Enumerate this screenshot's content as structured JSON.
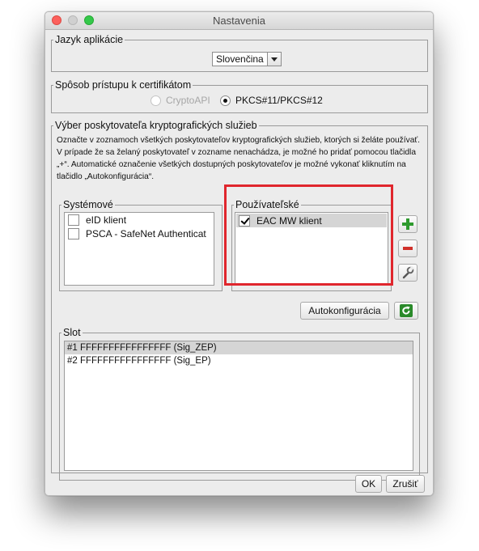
{
  "window": {
    "title": "Nastavenia"
  },
  "language": {
    "legend": "Jazyk aplikácie",
    "selected": "Slovenčina"
  },
  "access": {
    "legend": "Spôsob prístupu k certifikátom",
    "options": [
      {
        "label": "CryptoAPI",
        "selected": false,
        "enabled": false
      },
      {
        "label": "PKCS#11/PKCS#12",
        "selected": true,
        "enabled": true
      }
    ]
  },
  "providers": {
    "legend": "Výber poskytovateľa kryptografických služieb",
    "description": "Označte v zoznamoch všetkých poskytovateľov kryptografických služieb, ktorých si želáte používať. V prípade že sa želaný poskytovateľ v zozname nenachádza, je možné ho pridať pomocou tlačidla „+“. Automatické označenie všetkých dostupných poskytovateľov je možné vykonať kliknutím na tlačidlo „Autokonfigurácia“.",
    "system": {
      "legend": "Systémové",
      "items": [
        {
          "label": "eID klient",
          "checked": false
        },
        {
          "label": "PSCA - SafeNet Authenticat",
          "checked": false
        }
      ]
    },
    "user": {
      "legend": "Používateľské",
      "items": [
        {
          "label": "EAC MW klient",
          "checked": true,
          "selected": true
        }
      ]
    },
    "autoconfig_label": "Autokonfigurácia"
  },
  "slot": {
    "legend": "Slot",
    "rows": [
      {
        "label": "#1 FFFFFFFFFFFFFFFF (Sig_ZEP)",
        "selected": true
      },
      {
        "label": "#2 FFFFFFFFFFFFFFFF (Sig_EP)",
        "selected": false
      }
    ]
  },
  "footer": {
    "ok_label": "OK",
    "cancel_label": "Zrušiť"
  },
  "icons": {
    "add": "plus-icon",
    "remove": "minus-icon",
    "edit": "wrench-icon",
    "refresh": "refresh-icon"
  },
  "colors": {
    "highlight_box": "#e0262d",
    "add_green": "#2e9a2e",
    "remove_red": "#d0302a",
    "selection": "#d5d5d5"
  }
}
